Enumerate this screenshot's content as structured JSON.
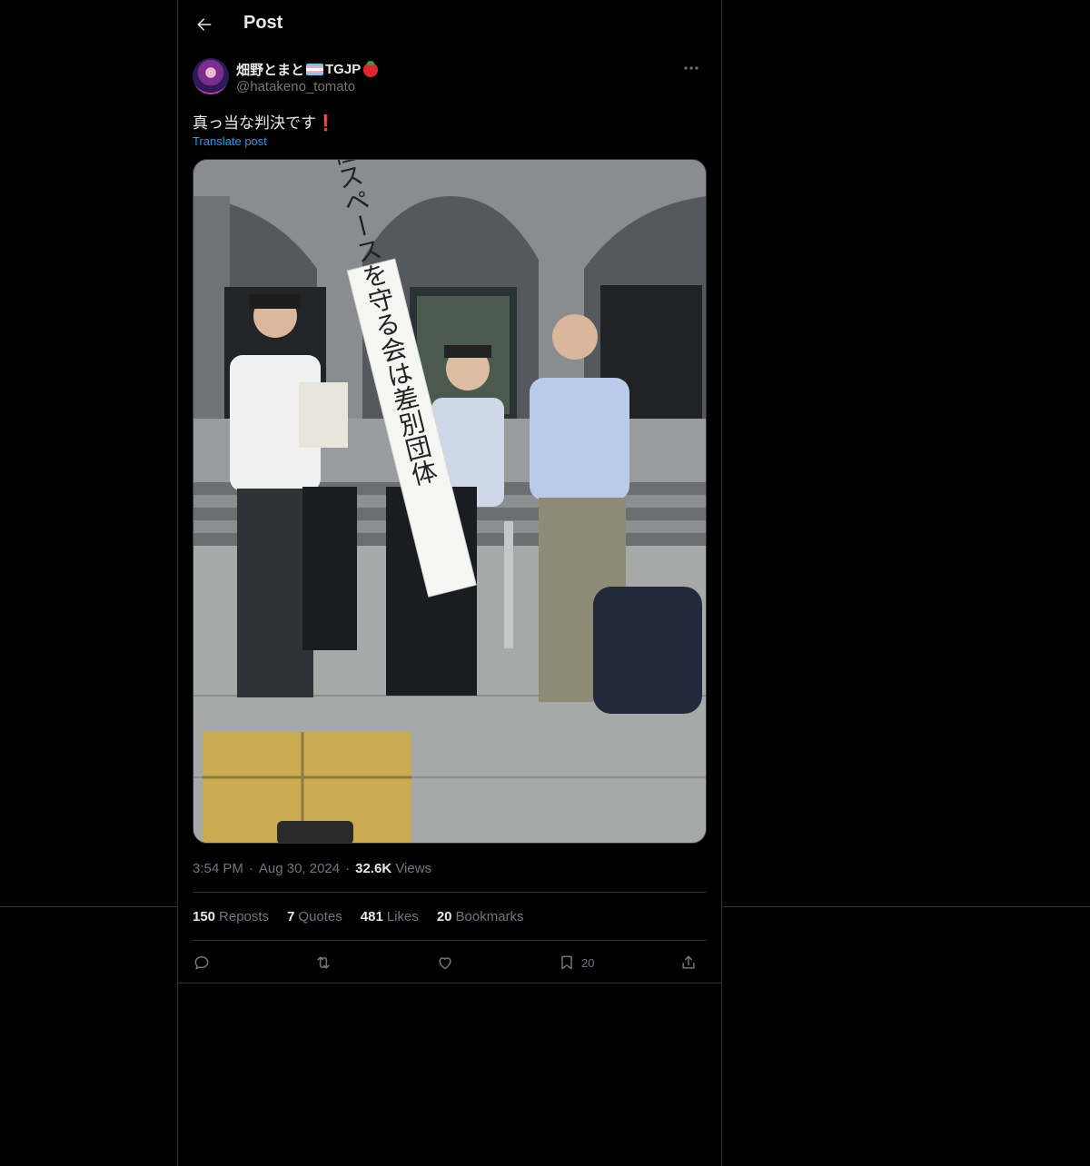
{
  "header": {
    "title": "Post"
  },
  "author": {
    "display_name": "畑野とまと",
    "display_suffix": "TGJP",
    "handle": "@hatakeno_tomato"
  },
  "post": {
    "text": "真っ当な判決です",
    "emoji": "❗",
    "translate_label": "Translate post",
    "banner_text": "女性スペースを守る会は差別団体"
  },
  "meta": {
    "time": "3:54 PM",
    "dot": "·",
    "date": "Aug 30, 2024",
    "views_count": "32.6K",
    "views_label": "Views"
  },
  "stats": {
    "reposts_count": "150",
    "reposts_label": "Reposts",
    "quotes_count": "7",
    "quotes_label": "Quotes",
    "likes_count": "481",
    "likes_label": "Likes",
    "bookmarks_count": "20",
    "bookmarks_label": "Bookmarks"
  },
  "actions": {
    "bookmark_count": "20"
  },
  "icons": {
    "back": "back-arrow-icon",
    "more": "more-icon",
    "reply": "reply-icon",
    "repost": "repost-icon",
    "like": "heart-icon",
    "bookmark": "bookmark-icon",
    "share": "share-icon"
  },
  "colors": {
    "background": "#000000",
    "text": "#e7e9ea",
    "secondary": "#71767b",
    "link": "#1d9bf0",
    "border": "#2f3336"
  }
}
